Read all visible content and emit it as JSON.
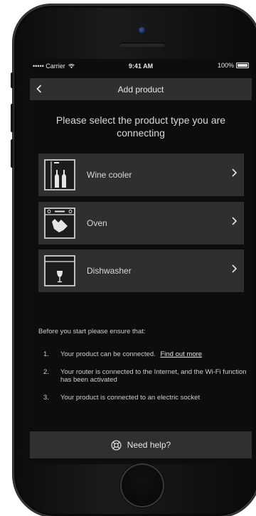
{
  "status_bar": {
    "carrier": "••••• Carrier",
    "time": "9:41 AM",
    "battery": "100%"
  },
  "nav": {
    "title": "Add product",
    "back_icon": "chevron-left-icon"
  },
  "heading": "Please select the product type you are connecting",
  "products": [
    {
      "label": "Wine cooler",
      "icon": "wine-cooler-icon"
    },
    {
      "label": "Oven",
      "icon": "oven-icon"
    },
    {
      "label": "Dishwasher",
      "icon": "dishwasher-icon"
    }
  ],
  "checklist": {
    "intro": "Before you start please ensure that:",
    "items": [
      {
        "num": "1.",
        "text": "Your product can be connected.",
        "link": "Find out more"
      },
      {
        "num": "2.",
        "text": "Your router is connected to the Internet, and the Wi-Fi function has been activated"
      },
      {
        "num": "3.",
        "text": "Your product is connected to an electric socket"
      }
    ]
  },
  "help": {
    "label": "Need help?",
    "icon": "lifebuoy-icon"
  },
  "colors": {
    "screen_bg": "#0d0d0d",
    "card_bg": "#2f2f2f",
    "text": "#d8d8d8"
  }
}
